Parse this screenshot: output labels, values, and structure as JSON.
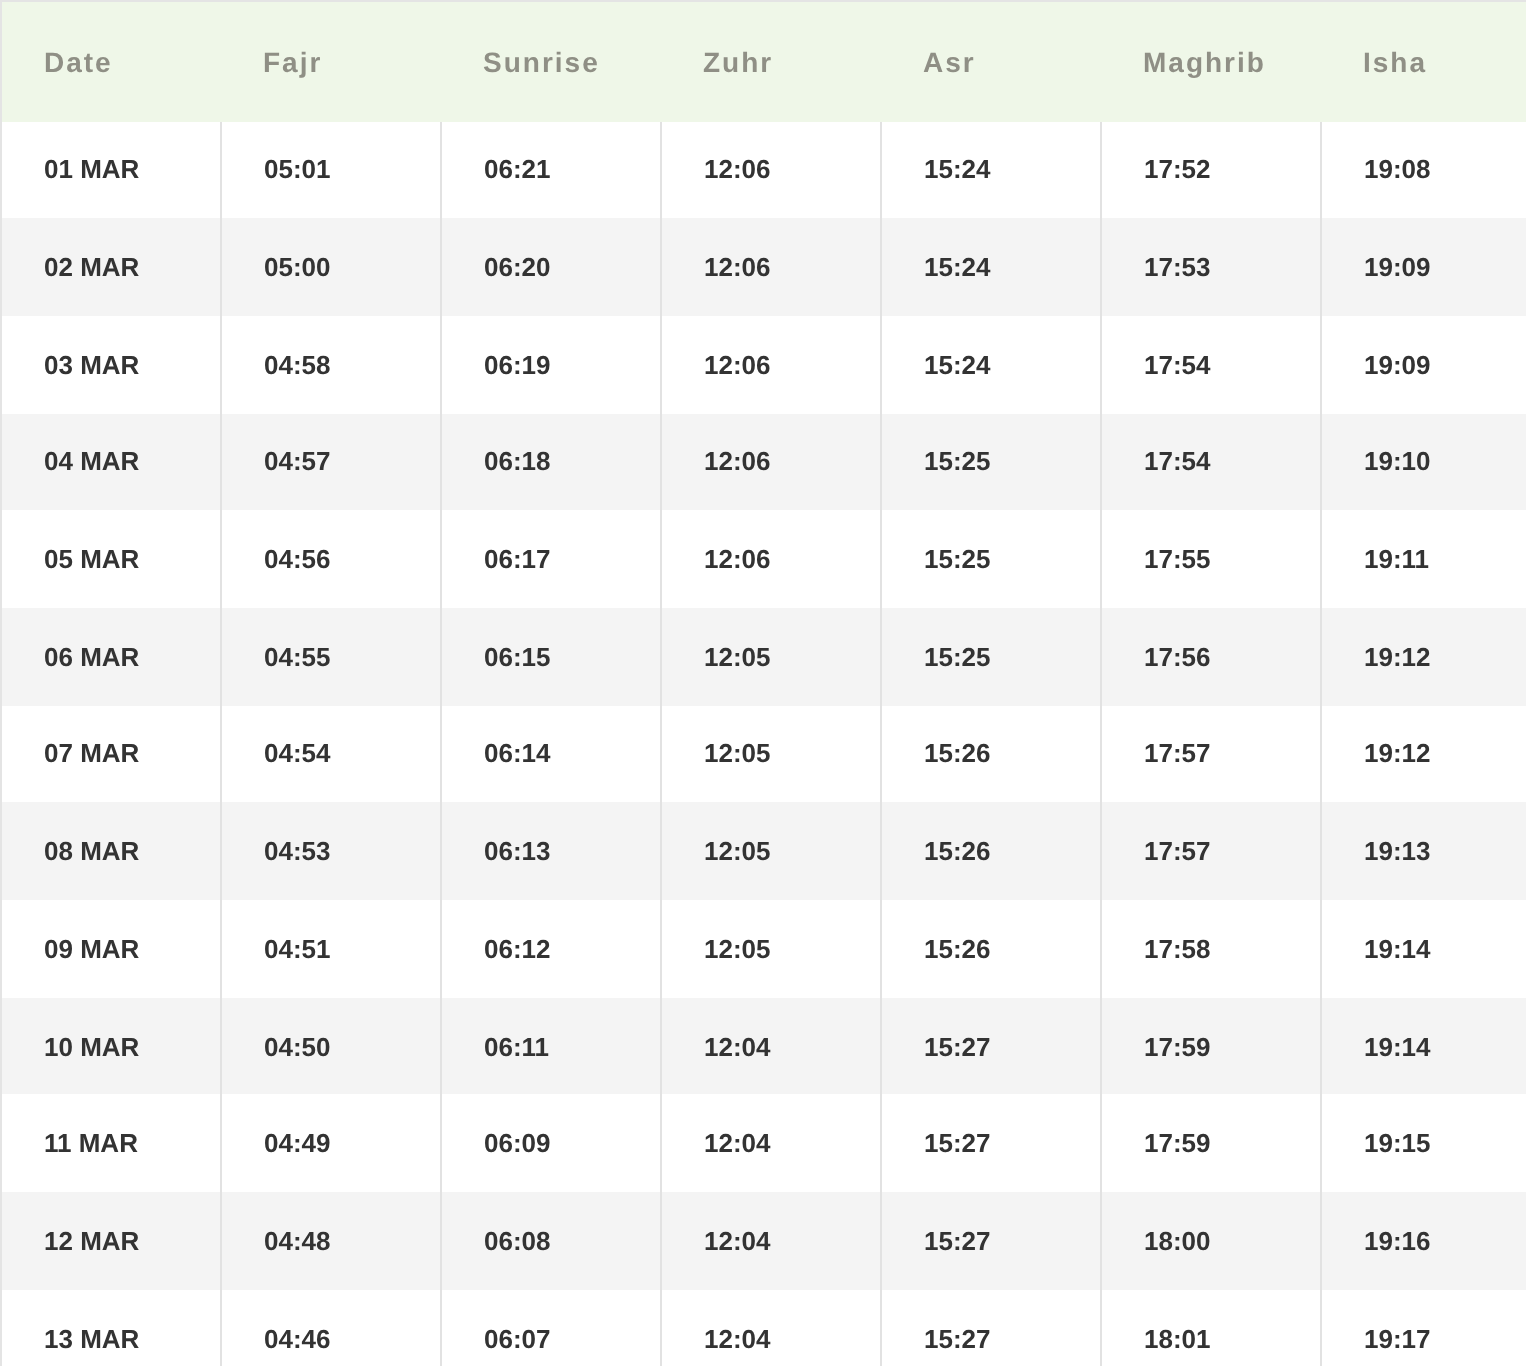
{
  "table": {
    "columns": [
      "Date",
      "Fajr",
      "Sunrise",
      "Zuhr",
      "Asr",
      "Maghrib",
      "Isha"
    ],
    "rows": [
      [
        "01 MAR",
        "05:01",
        "06:21",
        "12:06",
        "15:24",
        "17:52",
        "19:08"
      ],
      [
        "02 MAR",
        "05:00",
        "06:20",
        "12:06",
        "15:24",
        "17:53",
        "19:09"
      ],
      [
        "03 MAR",
        "04:58",
        "06:19",
        "12:06",
        "15:24",
        "17:54",
        "19:09"
      ],
      [
        "04 MAR",
        "04:57",
        "06:18",
        "12:06",
        "15:25",
        "17:54",
        "19:10"
      ],
      [
        "05 MAR",
        "04:56",
        "06:17",
        "12:06",
        "15:25",
        "17:55",
        "19:11"
      ],
      [
        "06 MAR",
        "04:55",
        "06:15",
        "12:05",
        "15:25",
        "17:56",
        "19:12"
      ],
      [
        "07 MAR",
        "04:54",
        "06:14",
        "12:05",
        "15:26",
        "17:57",
        "19:12"
      ],
      [
        "08 MAR",
        "04:53",
        "06:13",
        "12:05",
        "15:26",
        "17:57",
        "19:13"
      ],
      [
        "09 MAR",
        "04:51",
        "06:12",
        "12:05",
        "15:26",
        "17:58",
        "19:14"
      ],
      [
        "10 MAR",
        "04:50",
        "06:11",
        "12:04",
        "15:27",
        "17:59",
        "19:14"
      ],
      [
        "11 MAR",
        "04:49",
        "06:09",
        "12:04",
        "15:27",
        "17:59",
        "19:15"
      ],
      [
        "12 MAR",
        "04:48",
        "06:08",
        "12:04",
        "15:27",
        "18:00",
        "19:16"
      ],
      [
        "13 MAR",
        "04:46",
        "06:07",
        "12:04",
        "15:27",
        "18:01",
        "19:17"
      ]
    ]
  }
}
